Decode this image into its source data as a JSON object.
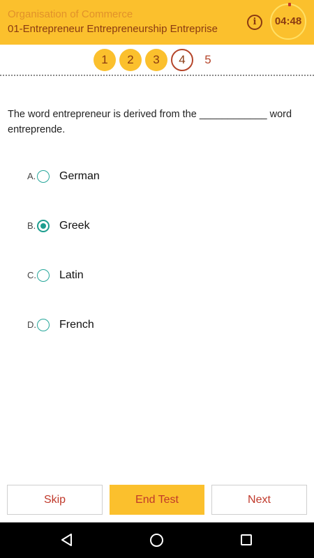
{
  "header": {
    "subtitle": "Organisation of Commerce",
    "title": "01-Entrepreneur Entrepreneurship Entreprise",
    "info_icon": "i",
    "timer": "04:48"
  },
  "question_nav": [
    {
      "label": "1",
      "state": "answered"
    },
    {
      "label": "2",
      "state": "answered"
    },
    {
      "label": "3",
      "state": "answered"
    },
    {
      "label": "4",
      "state": "current"
    },
    {
      "label": "5",
      "state": "pending"
    }
  ],
  "question": {
    "text": "The word entrepreneur is derived from the ____________ word entreprende."
  },
  "options": [
    {
      "letter": "A.",
      "label": "German",
      "selected": false
    },
    {
      "letter": "B.",
      "label": "Greek",
      "selected": true
    },
    {
      "letter": "C.",
      "label": "Latin",
      "selected": false
    },
    {
      "letter": "D.",
      "label": "French",
      "selected": false
    }
  ],
  "buttons": {
    "skip": "Skip",
    "end_test": "End Test",
    "next": "Next"
  },
  "colors": {
    "accent": "#FBC02D",
    "text_dark": "#8a3a12",
    "button_text": "#c0392b",
    "radio": "#1e9e8f"
  }
}
